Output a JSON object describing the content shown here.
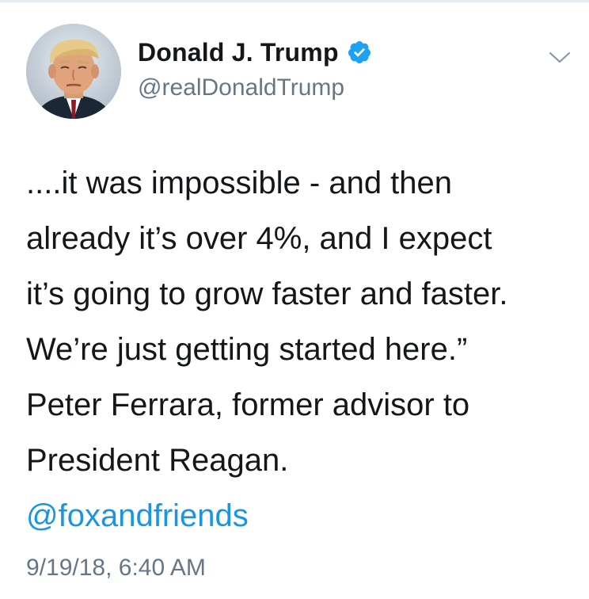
{
  "author": {
    "display_name": "Donald J. Trump",
    "handle": "@realDonaldTrump",
    "verified": true,
    "avatar_icon": "profile-photo-avatar"
  },
  "menu": {
    "icon": "chevron-down-icon"
  },
  "tweet": {
    "lines": [
      "....it was impossible - and then",
      "already it’s over 4%, and I expect",
      "it’s going to grow faster and faster.",
      "We’re just getting started here.”",
      "Peter Ferrara, former advisor to",
      "President Reagan."
    ],
    "mention": "@foxandfriends",
    "timestamp": "9/19/18, 6:40 AM"
  },
  "colors": {
    "text": "#14171a",
    "secondary": "#657786",
    "link": "#1b95e0",
    "verified_badge": "#1da1f2"
  }
}
